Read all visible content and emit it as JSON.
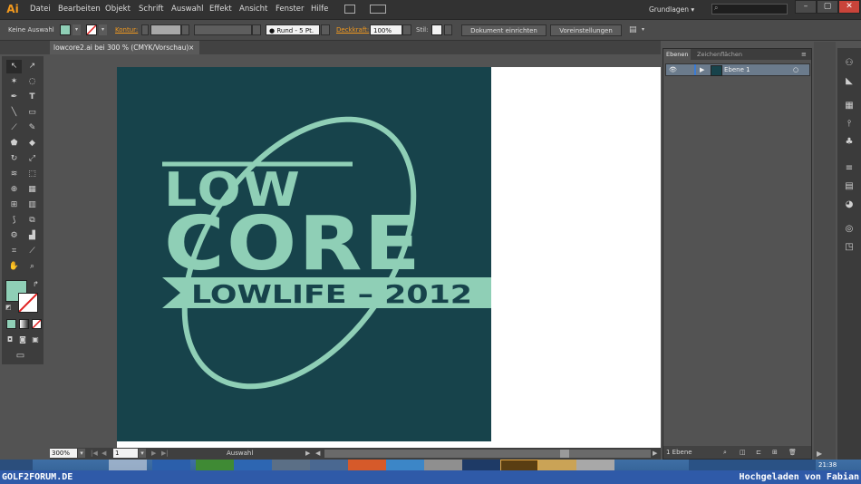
{
  "app": {
    "logo": "Ai",
    "accent": "#f39a1e"
  },
  "menu": [
    "Datei",
    "Bearbeiten",
    "Objekt",
    "Schrift",
    "Auswahl",
    "Effekt",
    "Ansicht",
    "Fenster",
    "Hilfe"
  ],
  "workspace": {
    "label": "Grundlagen ▾",
    "search_placeholder": ""
  },
  "window_controls": {
    "minimize": "–",
    "maximize": "▢",
    "close": "✕"
  },
  "control_bar": {
    "selection": "Keine Auswahl",
    "stroke_label": "Kontur:",
    "brush": "Rund - 5 Pt.",
    "opacity_label": "Deckkraft:",
    "opacity_value": "100%",
    "style_label": "Stil:",
    "doc_setup_button": "Dokument einrichten",
    "preferences_button": "Voreinstellungen"
  },
  "document": {
    "tab_title": "lowcore2.ai bei 300 % (CMYK/Vorschau)",
    "tab_close": "×"
  },
  "artwork": {
    "bg_color": "#17434b",
    "fg_color": "#8fcfb6",
    "word1": "LOW",
    "word2": "CORE",
    "banner_text": "LOWLIFE – 2012"
  },
  "status": {
    "zoom": "300%",
    "page": "1",
    "tool": "Auswahl"
  },
  "layers_panel": {
    "tabs": [
      "Ebenen",
      "Zeichenflächen"
    ],
    "layer_name": "Ebene 1",
    "footer_count": "1 Ebene"
  },
  "taskbar": {
    "clock": "21:38"
  },
  "footer": {
    "left": "GOLF2FORUM.DE",
    "right": "Hochgeladen von Fabian"
  }
}
